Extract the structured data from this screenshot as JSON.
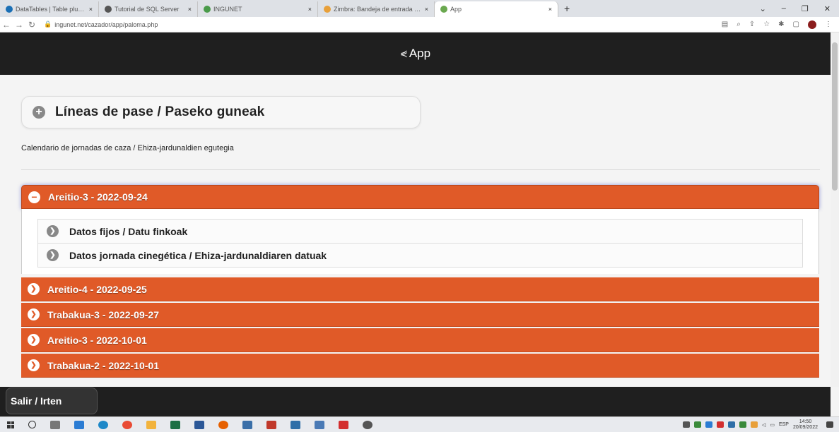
{
  "browser": {
    "tabs": [
      {
        "title": "DataTables | Table plug-in for j",
        "favicon_color": "#1a6fb5",
        "active": false
      },
      {
        "title": "Tutorial de SQL Server",
        "favicon_color": "#555555",
        "active": false
      },
      {
        "title": "INGUNET",
        "favicon_color": "#4a9b4a",
        "active": false
      },
      {
        "title": "Zimbra: Bandeja de entrada (3)",
        "favicon_color": "#e8a03a",
        "active": false
      },
      {
        "title": "App",
        "favicon_color": "#6aa84f",
        "active": true
      }
    ],
    "new_tab_glyph": "+",
    "close_glyph": "×",
    "url": "ingunet.net/cazador/app/paloma.php"
  },
  "header": {
    "title": "App"
  },
  "section": {
    "title": "Líneas de pase / Paseko guneak",
    "subtitle": "Calendario de jornadas de caza / Ehiza-jardunaldien egutegia"
  },
  "accordion": {
    "open_item": {
      "title": "Areitio-3 - 2022-09-24",
      "sub_items": [
        {
          "label": "Datos fijos / Datu finkoak"
        },
        {
          "label": "Datos jornada cinegética / Ehiza-jardunaldiaren datuak"
        }
      ]
    },
    "items": [
      {
        "title": "Areitio-4 - 2022-09-25"
      },
      {
        "title": "Trabakua-3 - 2022-09-27"
      },
      {
        "title": "Areitio-3 - 2022-10-01"
      },
      {
        "title": "Trabakua-2 - 2022-10-01"
      }
    ]
  },
  "footer": {
    "exit_label": "Salir / Irten"
  },
  "taskbar": {
    "language": "ESP",
    "time": "14:50",
    "date": "20/09/2022"
  },
  "colors": {
    "accent": "#e05a28",
    "header_bg": "#1f1f1f"
  }
}
